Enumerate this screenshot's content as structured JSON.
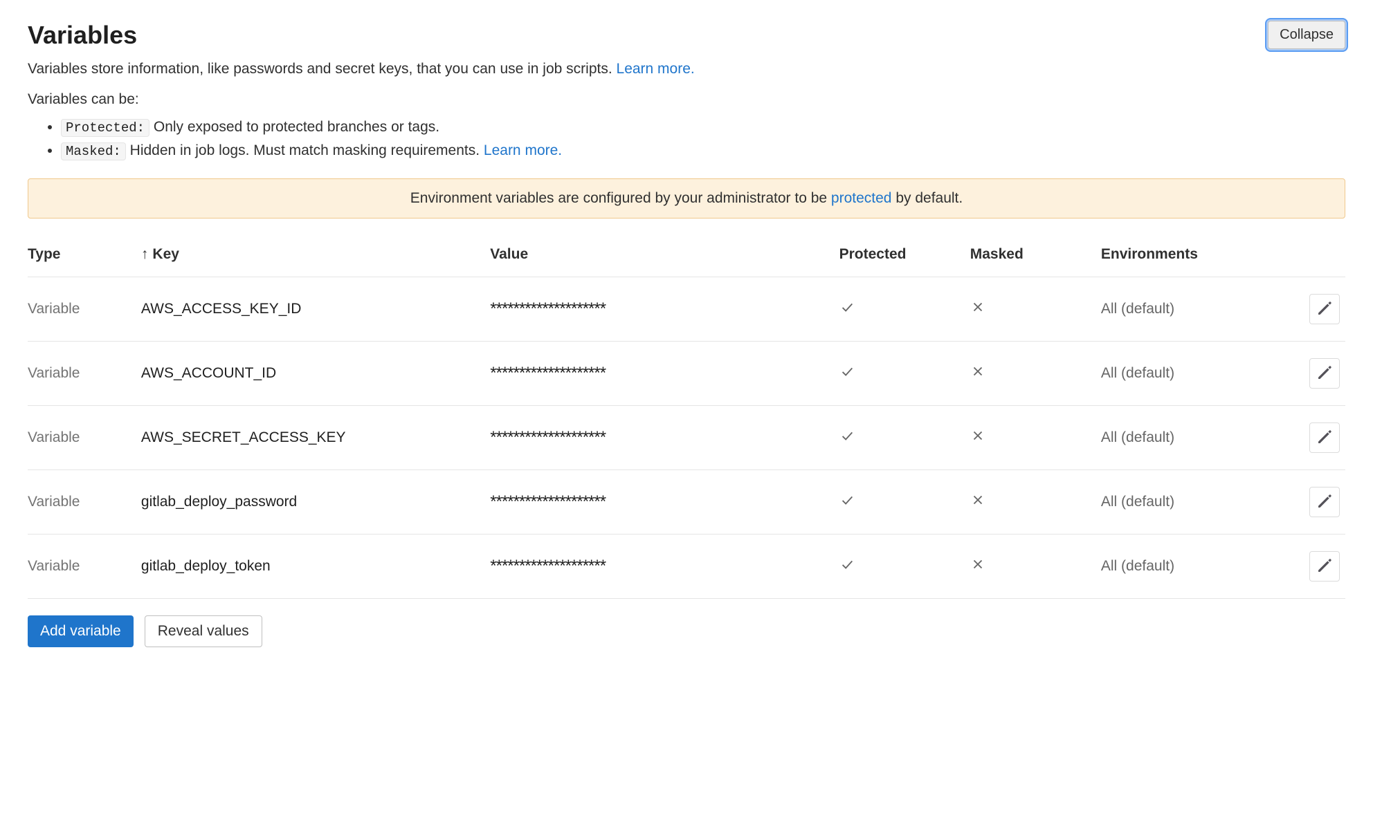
{
  "header": {
    "title": "Variables",
    "collapse_label": "Collapse"
  },
  "description": {
    "text_prefix": "Variables store information, like passwords and secret keys, that you can use in job scripts. ",
    "learn_more": "Learn more."
  },
  "variables_can_be": "Variables can be:",
  "bullets": {
    "protected": {
      "code": "Protected:",
      "text": " Only exposed to protected branches or tags."
    },
    "masked": {
      "code": "Masked:",
      "text": " Hidden in job logs. Must match masking requirements. ",
      "learn_more": "Learn more."
    }
  },
  "alert": {
    "prefix": "Environment variables are configured by your administrator to be ",
    "link": "protected",
    "suffix": " by default."
  },
  "table": {
    "headers": {
      "type": "Type",
      "key": "Key",
      "value": "Value",
      "protected": "Protected",
      "masked": "Masked",
      "environments": "Environments"
    },
    "rows": [
      {
        "type": "Variable",
        "key": "AWS_ACCESS_KEY_ID",
        "value": "********************",
        "protected": true,
        "masked": false,
        "environments": "All (default)"
      },
      {
        "type": "Variable",
        "key": "AWS_ACCOUNT_ID",
        "value": "********************",
        "protected": true,
        "masked": false,
        "environments": "All (default)"
      },
      {
        "type": "Variable",
        "key": "AWS_SECRET_ACCESS_KEY",
        "value": "********************",
        "protected": true,
        "masked": false,
        "environments": "All (default)"
      },
      {
        "type": "Variable",
        "key": "gitlab_deploy_password",
        "value": "********************",
        "protected": true,
        "masked": false,
        "environments": "All (default)"
      },
      {
        "type": "Variable",
        "key": "gitlab_deploy_token",
        "value": "********************",
        "protected": true,
        "masked": false,
        "environments": "All (default)"
      }
    ]
  },
  "footer": {
    "add_variable": "Add variable",
    "reveal_values": "Reveal values"
  }
}
